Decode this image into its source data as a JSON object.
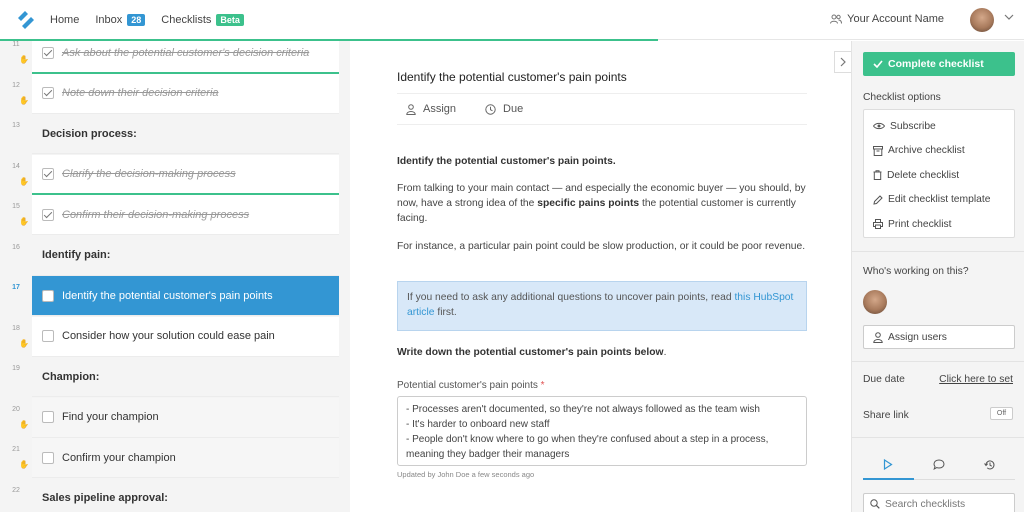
{
  "nav": {
    "home": "Home",
    "inbox": "Inbox",
    "inbox_count": "28",
    "checklists": "Checklists",
    "beta": "Beta",
    "account": "Your Account Name"
  },
  "tasks": [
    {
      "num": "11",
      "label": "Ask about the potential customer's decision criteria",
      "type": "done"
    },
    {
      "num": "12",
      "label": "Note down their decision criteria",
      "type": "done"
    },
    {
      "num": "13",
      "label": "Decision process:",
      "type": "heading"
    },
    {
      "num": "14",
      "label": "Clarify the decision-making process",
      "type": "done"
    },
    {
      "num": "15",
      "label": "Confirm their decision-making process",
      "type": "done"
    },
    {
      "num": "16",
      "label": "Identify pain:",
      "type": "heading"
    },
    {
      "num": "17",
      "label": "Identify the potential customer's pain points",
      "type": "active"
    },
    {
      "num": "18",
      "label": "Consider how your solution could ease pain",
      "type": "todo"
    },
    {
      "num": "19",
      "label": "Champion:",
      "type": "heading"
    },
    {
      "num": "20",
      "label": "Find your champion",
      "type": "todo-gray"
    },
    {
      "num": "21",
      "label": "Confirm your champion",
      "type": "todo-gray"
    },
    {
      "num": "22",
      "label": "Sales pipeline approval:",
      "type": "heading"
    }
  ],
  "task": {
    "title": "Identify the potential customer's pain points",
    "assign": "Assign",
    "due": "Due",
    "heading": "Identify the potential customer's pain points.",
    "p1_a": "From talking to your main contact — and especially the economic buyer — you should, by now, have a strong idea of the ",
    "p1_b": "specific pains points",
    "p1_c": " the potential customer is currently facing.",
    "p2": "For instance, a particular pain point could be slow production, or it could be poor revenue.",
    "info_a": "If you need to ask any additional questions to uncover pain points, read ",
    "info_link": "this HubSpot article",
    "info_b": " first.",
    "write_heading": "Write down the potential customer's pain points below",
    "write_period": ".",
    "field_label": "Potential customer's pain points",
    "field_req": "*",
    "field_value": "- Processes aren't documented, so they're not always followed as the team wish\n- It's harder to onboard new staff\n- People don't know where to go when they're confused about a step in a process, meaning they badger their managers",
    "updated": "Updated by John Doe a few seconds ago"
  },
  "sidebar": {
    "complete": "Complete checklist",
    "options_title": "Checklist options",
    "options": [
      {
        "label": "Subscribe",
        "icon": "eye-icon"
      },
      {
        "label": "Archive checklist",
        "icon": "archive-icon"
      },
      {
        "label": "Delete checklist",
        "icon": "trash-icon"
      },
      {
        "label": "Edit checklist template",
        "icon": "pencil-icon"
      },
      {
        "label": "Print checklist",
        "icon": "printer-icon"
      }
    ],
    "working": "Who's working on this?",
    "assign_users": "Assign users",
    "due_date": "Due date",
    "due_link": "Click here to set",
    "share": "Share link",
    "share_toggle": "Off",
    "search_placeholder": "Search checklists"
  },
  "colors": {
    "accent": "#3396d3",
    "green": "#3cc18c"
  }
}
